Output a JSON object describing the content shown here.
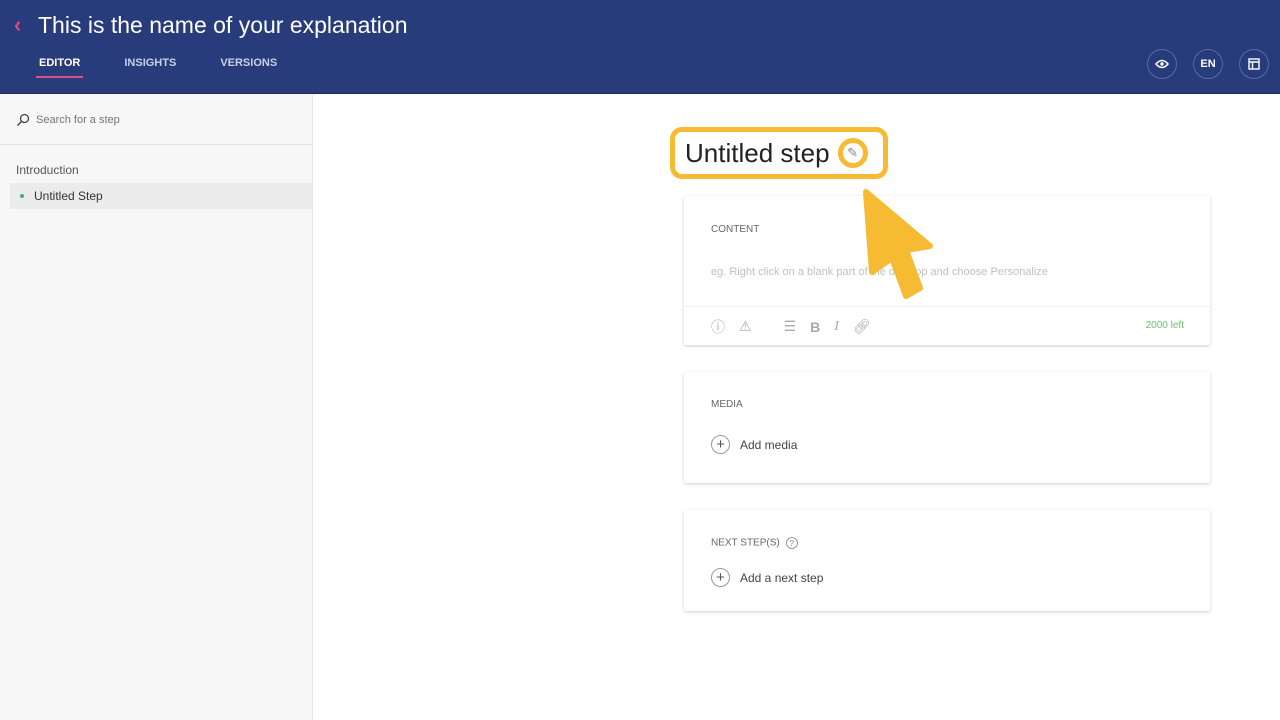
{
  "header": {
    "title": "This is the name of your explanation",
    "tabs": [
      {
        "label": "EDITOR",
        "active": true
      },
      {
        "label": "INSIGHTS"
      },
      {
        "label": "VERSIONS"
      }
    ],
    "lang": "EN"
  },
  "sidebar": {
    "search_placeholder": "Search for a step",
    "section": "Introduction",
    "items": [
      {
        "label": "Untitled Step"
      }
    ]
  },
  "step": {
    "title": "Untitled step"
  },
  "content": {
    "label": "CONTENT",
    "placeholder": "eg. Right click on a blank part of the desktop and choose Personalize",
    "chars_left": "2000 left"
  },
  "media": {
    "label": "MEDIA",
    "add": "Add media"
  },
  "next": {
    "label": "NEXT STEP(S)",
    "add": "Add a next step"
  },
  "colors": {
    "header": "#283b7b",
    "accent": "#d9538a",
    "highlight": "#f7bb33",
    "counter": "#6cbf6c"
  }
}
